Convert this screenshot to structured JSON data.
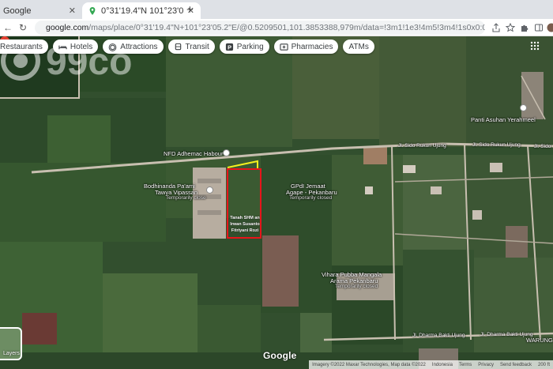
{
  "browser": {
    "inactive_tab": "Google",
    "active_tab": "0°31'19.4\"N 101°23'05.2\"E - G",
    "url_host": "google.com",
    "url_path": "/maps/place/0°31'19.4\"N+101°23'05.2\"E/@0.5209501,101.3853388,979m/data=!3m1!1e3!4m5!3m4!1s0x0:0xf0ec4497498b71d!8m2!3d0.52..."
  },
  "chips": [
    "Restaurants",
    "Hotels",
    "Attractions",
    "Transit",
    "Parking",
    "Pharmacies",
    "ATMs"
  ],
  "places": {
    "nfd": "NFD Adhemac Habour",
    "bodhinanda_1": "Bodhinanda Pa'ami",
    "bodhinanda_2": "Tawya Vipassan",
    "bodhinanda_3": "Temporarily close",
    "gpdi_1": "GPdI Jemaat",
    "gpdi_2": "Agape - Pekanbaru",
    "gpdi_3": "Temporarily closed",
    "panti": "Panti Asuhan Yerahmeel",
    "vihara_1": "Vihara Pubba Mangala",
    "vihara_2": "Arama Pekanbaru",
    "vihara_3": "Temporarily closed",
    "warung": "WARUNG"
  },
  "roads": {
    "sido_1": "Jl. Sido Rukun Ujung",
    "sido_2": "Jl. Sido Rukun Ujung",
    "sido_3": "Jl. Sido",
    "dharma_1": "Jl. Dharma Bakti Ujung",
    "dharma_2": "Jl. Dharma Bakti Ujung"
  },
  "parcel_label": [
    "Tanah SHM an",
    "Irwan Susanto",
    "Fitriyani Rozi"
  ],
  "watermark": "99co",
  "logo": "Google",
  "layers_label": "Layers",
  "attribution": [
    "Imagery ©2022 Maxar Technologies, Map data ©2022",
    "Indonesia",
    "Terms",
    "Privacy",
    "Send feedback",
    "200 ft"
  ],
  "colors": {
    "parcel_outline": "#e8141a",
    "access_line": "#f4f01e",
    "pin": "#ea4335"
  }
}
